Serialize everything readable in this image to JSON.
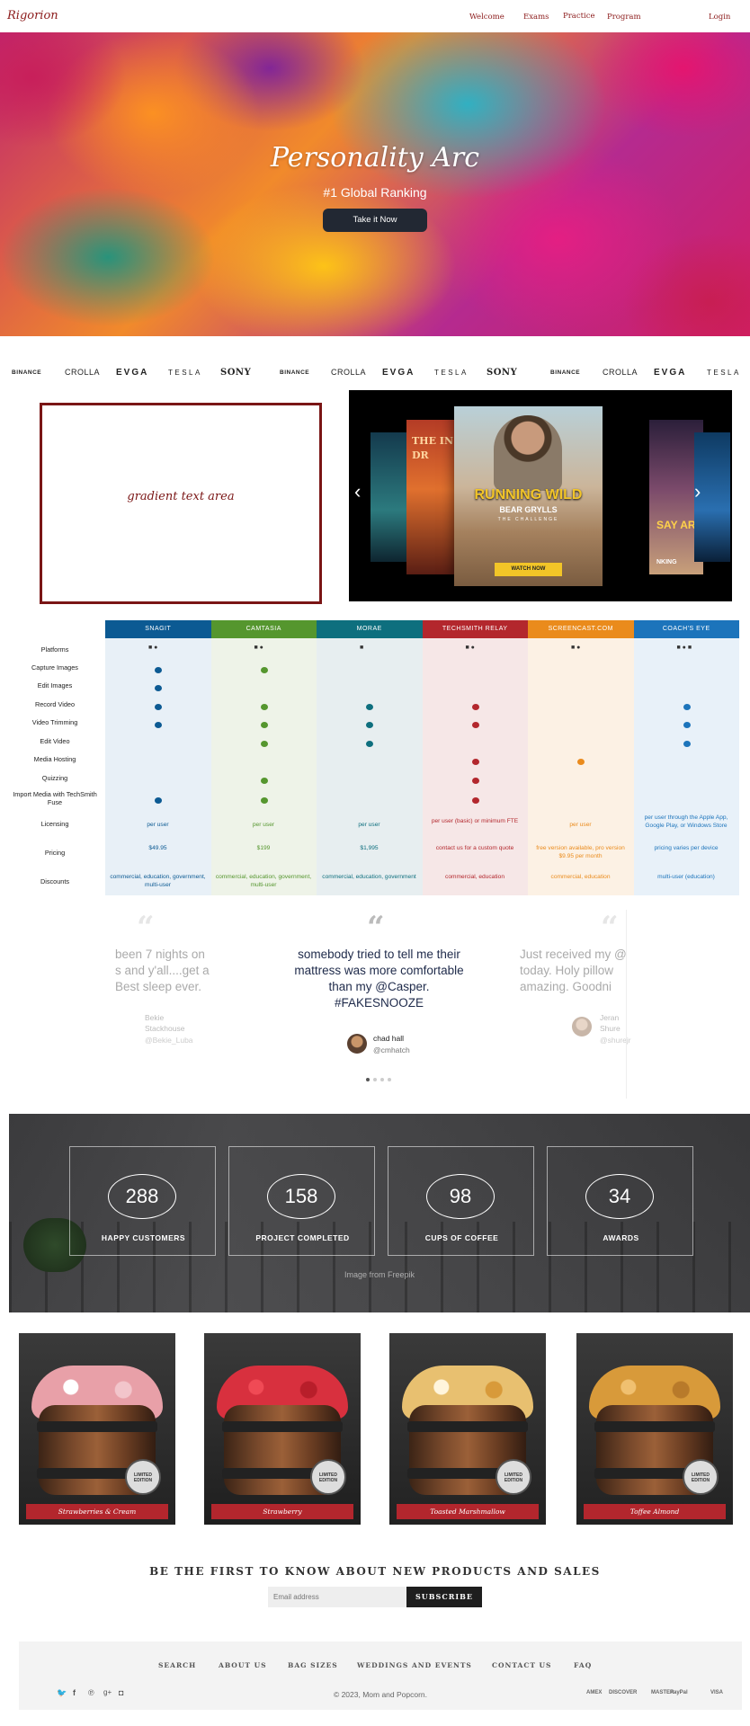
{
  "nav": {
    "brand": "Rigorion",
    "links": [
      "Welcome",
      "Exams",
      "Practice",
      "Program"
    ],
    "login": "Login"
  },
  "hero": {
    "title": "Personality Arc",
    "subtitle": "#1 Global Ranking",
    "cta": "Take it Now"
  },
  "logos": [
    "BINANCE",
    "CROLLA",
    "EVGA",
    "TESLA",
    "SONY",
    "BINANCE",
    "CROLLA",
    "EVGA",
    "TESLA",
    "SONY",
    "BINANCE",
    "CROLLA",
    "EVGA",
    "TESLA"
  ],
  "gradient_box": {
    "text": "gradient text area"
  },
  "carousel": {
    "posters": [
      "THE IN DR",
      "RUNNING WILD",
      "BEAR GRYLLS",
      "THE CHALLENGE",
      "SAY AR",
      "NKING"
    ],
    "cta": "WATCH NOW",
    "prev": "‹",
    "next": "›"
  },
  "comparison": {
    "columns": [
      {
        "name": "SNAGIT",
        "color": "#0c5a93",
        "bg": "#e8f0f7"
      },
      {
        "name": "CAMTASIA",
        "color": "#55962e",
        "bg": "#eef3e8"
      },
      {
        "name": "MORAE",
        "color": "#0e6f7e",
        "bg": "#e7eef0"
      },
      {
        "name": "TECHSMITH RELAY",
        "color": "#b3272d",
        "bg": "#f6e7e7"
      },
      {
        "name": "SCREENCAST.COM",
        "color": "#ea8b1c",
        "bg": "#fcf1e4"
      },
      {
        "name": "COACH'S EYE",
        "color": "#1c74bb",
        "bg": "#e8f1f9"
      }
    ],
    "rows": [
      "Platforms",
      "Capture Images",
      "Edit Images",
      "Record Video",
      "Video Trimming",
      "Edit Video",
      "Media Hosting",
      "Quizzing",
      "Import Media with TechSmith Fuse",
      "Licensing",
      "Pricing",
      "Discounts"
    ],
    "platforms": [
      "■ ●",
      "■ ●",
      "■",
      "■ ●",
      "■ ●",
      "■ ● ■"
    ],
    "features": [
      [
        1,
        1,
        0,
        0,
        0,
        0
      ],
      [
        1,
        0,
        0,
        0,
        0,
        0
      ],
      [
        1,
        1,
        1,
        1,
        0,
        1
      ],
      [
        1,
        1,
        1,
        1,
        0,
        1
      ],
      [
        0,
        1,
        1,
        0,
        0,
        1
      ],
      [
        0,
        0,
        0,
        1,
        1,
        0
      ],
      [
        0,
        1,
        0,
        1,
        0,
        0
      ],
      [
        1,
        1,
        0,
        1,
        0,
        0
      ]
    ],
    "licensing": [
      "per user",
      "per user",
      "per user",
      "per user (basic) or minimum FTE",
      "per user",
      "per user through the Apple App, Google Play, or Windows Store"
    ],
    "pricing": [
      "$49.95",
      "$199",
      "$1,995",
      "contact us for a custom quote",
      "free version available, pro version $9.95 per month",
      "pricing varies per device"
    ],
    "discounts": [
      "commercial, education, government, multi-user",
      "commercial, education, government, multi-user",
      "commercial, education, government",
      "commercial, education",
      "commercial, education",
      "multi-user (education)"
    ]
  },
  "testimonials": {
    "left": {
      "text": "been 7 nights on\ns and y'all....get a\nBest sleep ever.",
      "name": "Bekie\nStackhouse",
      "handle": "@Bekie_Luba"
    },
    "center": {
      "text": "somebody tried to tell me their mattress was more comfortable than my @Casper. #FAKESNOOZE",
      "name": "chad hall",
      "handle": "@cmhatch"
    },
    "right": {
      "text": "Just received my @\ntoday. Holy pillow\namazing. Goodni",
      "name": "Jeran\nShure",
      "handle": "@shurejr"
    },
    "pages": 4,
    "active_page": 1
  },
  "stats": {
    "items": [
      {
        "value": "288",
        "label": "HAPPY CUSTOMERS"
      },
      {
        "value": "158",
        "label": "PROJECT COMPLETED"
      },
      {
        "value": "98",
        "label": "CUPS OF COFFEE"
      },
      {
        "value": "34",
        "label": "AWARDS"
      }
    ],
    "credit": "Image from Freepik"
  },
  "products": [
    {
      "name": "Strawberries & Cream",
      "kernel": "#e8a0a8",
      "seal": "LIMITED EDITION"
    },
    {
      "name": "Strawberry",
      "kernel": "#d8303e",
      "seal": "LIMITED EDITION"
    },
    {
      "name": "Toasted Marshmallow",
      "kernel": "#e8c070",
      "seal": "LIMITED EDITION"
    },
    {
      "name": "Toffee Almond",
      "kernel": "#d89a3a",
      "seal": "LIMITED EDITION"
    }
  ],
  "newsletter": {
    "title": "BE THE FIRST TO KNOW ABOUT NEW PRODUCTS AND SALES",
    "placeholder": "Email address",
    "button": "SUBSCRIBE"
  },
  "footer": {
    "links": [
      "SEARCH",
      "ABOUT US",
      "BAG SIZES",
      "WEDDINGS AND EVENTS",
      "CONTACT US",
      "FAQ"
    ],
    "social": [
      "twitter-icon",
      "facebook-icon",
      "pinterest-icon",
      "googleplus-icon",
      "instagram-icon"
    ],
    "copyright": "© 2023, Mom and Popcorn.",
    "payments": [
      "AMEX",
      "DISCOVER",
      "MASTER",
      "PayPal",
      "VISA"
    ]
  }
}
